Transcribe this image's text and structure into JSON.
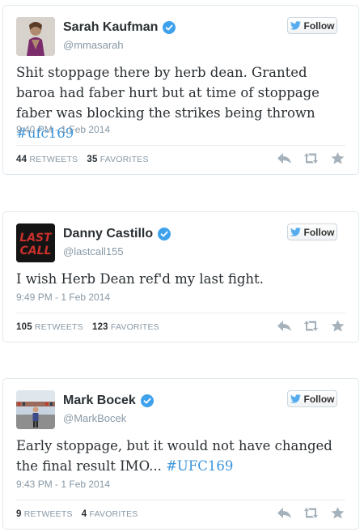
{
  "tweets": [
    {
      "name": "Sarah Kaufman",
      "handle": "@mmasarah",
      "follow_label": "Follow",
      "text_parts": [
        "Shit stoppage there by herb dean. Granted baroa had faber hurt but at time of stoppage faber was blocking the strikes being thrown ",
        "#ufc169"
      ],
      "time": "9:40 PM - 1 Feb 2014",
      "retweets": "44",
      "retweets_label": "RETWEETS",
      "favorites": "35",
      "favorites_label": "FAVORITES"
    },
    {
      "name": "Danny Castillo",
      "handle": "@lastcall155",
      "follow_label": "Follow",
      "avatar_text": "LAST CALL",
      "text_parts": [
        "I wish Herb Dean ref'd my last fight.",
        ""
      ],
      "time": "9:49 PM - 1 Feb 2014",
      "retweets": "105",
      "retweets_label": "RETWEETS",
      "favorites": "123",
      "favorites_label": "FAVORITES"
    },
    {
      "name": "Mark Bocek",
      "handle": "@MarkBocek",
      "follow_label": "Follow",
      "text_parts": [
        "Early stoppage, but it would not have changed the final result IMO... ",
        "#UFC169"
      ],
      "time": "9:43 PM - 1 Feb 2014",
      "retweets": "9",
      "retweets_label": "RETWEETS",
      "favorites": "4",
      "favorites_label": "FAVORITES"
    }
  ],
  "colors": {
    "hashtag": "#3b94d9",
    "verified": "#3ea1ec",
    "bird": "#55acee",
    "muted": "#8899a6"
  },
  "icons": [
    "verified-badge-icon",
    "twitter-bird-icon",
    "reply-icon",
    "retweet-icon",
    "favorite-star-icon"
  ]
}
